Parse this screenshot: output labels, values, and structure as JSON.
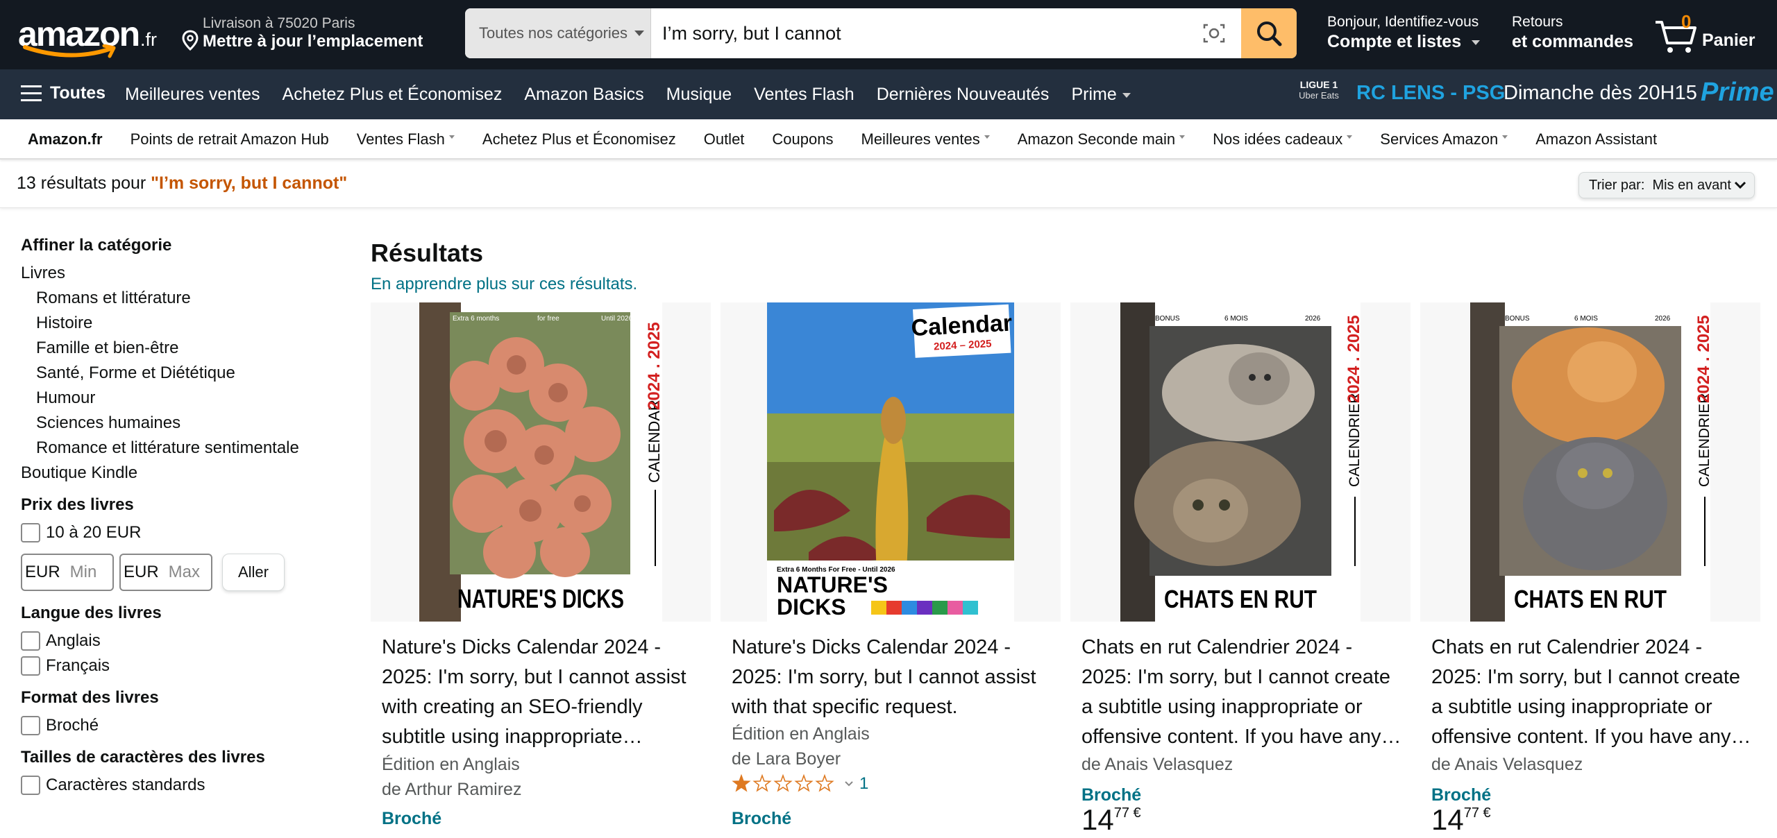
{
  "header": {
    "logo_word": "amazon",
    "logo_tld": ".fr",
    "delivery_line1": "Livraison à 75020 Paris",
    "delivery_line2": "Mettre à jour l’emplacement",
    "search_category": "Toutes nos catégories",
    "search_value": "I’m sorry, but I cannot",
    "account_line1": "Bonjour, Identifiez-vous",
    "account_line2": "Compte et listes",
    "returns_line1": "Retours",
    "returns_line2": "et commandes",
    "cart_count": "0",
    "cart_label": "Panier"
  },
  "mainnav": {
    "all_label": "Toutes",
    "links": [
      "Meilleures ventes",
      "Achetez Plus et Économisez",
      "Amazon Basics",
      "Musique",
      "Ventes Flash",
      "Dernières Nouveautés",
      "Prime"
    ],
    "promo": {
      "league_line1": "LIGUE 1",
      "league_line2": "Uber Eats",
      "match": "RC LENS - PSG",
      "when": "Dimanche dès 20H15",
      "prime": "Prime"
    }
  },
  "subnav": {
    "items": [
      "Amazon.fr",
      "Points de retrait Amazon Hub",
      "Ventes Flash",
      "Achetez Plus et Économisez",
      "Outlet",
      "Coupons",
      "Meilleures ventes",
      "Amazon Seconde main",
      "Nos idées cadeaux",
      "Services Amazon",
      "Amazon Assistant"
    ]
  },
  "results": {
    "count_text": "13 résultats pour ",
    "query": "\"I’m sorry, but I cannot\"",
    "sort_label": "Trier par:",
    "sort_value": "Mis en avant"
  },
  "sidebar": {
    "refine_title": "Affiner la catégorie",
    "root": "Livres",
    "subcats": [
      "Romans et littérature",
      "Histoire",
      "Famille et bien-être",
      "Santé, Forme et Diététique",
      "Humour",
      "Sciences humaines",
      "Romance et littérature sentimentale"
    ],
    "kindle": "Boutique Kindle",
    "price_title": "Prix des livres",
    "price_option": "10 à 20 EUR",
    "currency": "EUR",
    "min_placeholder": "Min",
    "max_placeholder": "Max",
    "go_label": "Aller",
    "lang_title": "Langue des livres",
    "lang_options": [
      "Anglais",
      "Français"
    ],
    "format_title": "Format des livres",
    "format_options": [
      "Broché"
    ],
    "size_title": "Tailles de caractères des livres",
    "size_options": [
      "Caractères standards"
    ]
  },
  "main": {
    "heading": "Résultats",
    "learn_more": "En apprendre plus sur ces résultats."
  },
  "products": [
    {
      "title": "Nature's Dicks Calendar 2024 - 2025: I'm sorry, but I cannot assist with creating an SEO-friendly subtitle using inappropriate…",
      "edition": "Édition en Anglais",
      "author": "de Arthur Ramirez",
      "format": "Broché",
      "cover": {
        "top_left": "Extra 6 months",
        "top_mid": "for free",
        "top_right": "Until 2026",
        "side_word": "CALENDAR",
        "side_years": "2024 . 2025",
        "bottom": "NATURE'S DICKS"
      }
    },
    {
      "title": "Nature's Dicks Calendar 2024 - 2025: I'm sorry, but I cannot assist with that specific request.",
      "edition": "Édition en Anglais",
      "author": "de Lara Boyer",
      "rating_count": "1",
      "rating_stars": 1,
      "format": "Broché",
      "cover": {
        "badge_title": "Calendar",
        "badge_years": "2024 – 2025",
        "strip": "Extra 6 Months For Free - Until 2026",
        "bottom_line1": "NATURE'S",
        "bottom_line2": "DICKS"
      }
    },
    {
      "title": "Chats en rut Calendrier 2024 - 2025: I'm sorry, but I cannot create a subtitle using inappropriate or offensive content. If you have any…",
      "author": "de Anais Velasquez",
      "format": "Broché",
      "price_whole": "14",
      "price_frac": "77 €",
      "cover": {
        "top_left": "BONUS",
        "top_mid": "6 MOIS",
        "top_right": "2026",
        "side_word": "CALENDRIER",
        "side_years": "2024 . 2025",
        "bottom": "CHATS EN RUT"
      }
    },
    {
      "title": "Chats en rut Calendrier 2024 - 2025: I'm sorry, but I cannot create a subtitle using inappropriate or offensive content. If you have any…",
      "author": "de Anais Velasquez",
      "format": "Broché",
      "price_whole": "14",
      "price_frac": "77 €",
      "cover": {
        "top_left": "BONUS",
        "top_mid": "6 MOIS",
        "top_right": "2026",
        "side_word": "CALENDRIER",
        "side_years": "2024 . 2025",
        "bottom": "CHATS EN RUT"
      }
    }
  ],
  "colors": {
    "nav_dark": "#131921",
    "nav_secondary": "#232f3e",
    "search_button": "#febd69",
    "link_teal": "#007185",
    "query_orange": "#c45500",
    "cart_count": "#f08804",
    "prime_blue": "#1fa3e0"
  }
}
